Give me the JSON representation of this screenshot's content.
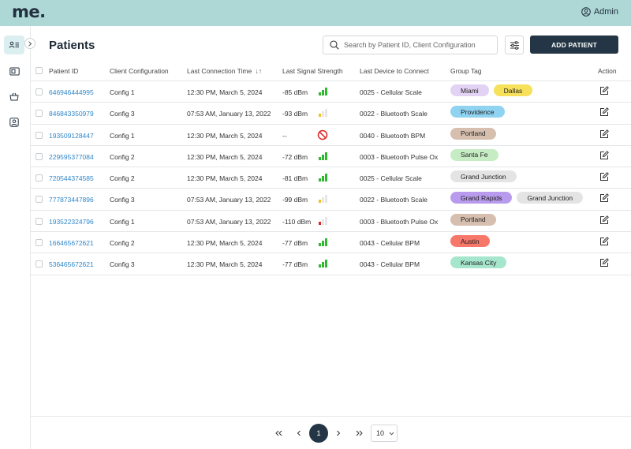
{
  "app": {
    "logo": "me.",
    "user_label": "Admin"
  },
  "sidebar": {
    "items": [
      {
        "icon": "patients-list-icon",
        "active": true
      },
      {
        "icon": "device-card-icon",
        "active": false
      },
      {
        "icon": "basket-icon",
        "active": false
      },
      {
        "icon": "user-profile-icon",
        "active": false
      }
    ],
    "collapse_icon": "chevron-right-icon"
  },
  "header": {
    "title": "Patients",
    "search_placeholder": "Search by Patient ID, Client Configuration",
    "add_button_label": "ADD PATIENT"
  },
  "table": {
    "columns": {
      "patient_id": "Patient ID",
      "client_configuration": "Client Configuration",
      "last_connection_time": "Last Connection Time",
      "last_signal_strength": "Last Signal Strength",
      "last_device": "Last Device to Connect",
      "group_tag": "Group Tag",
      "action": "Action"
    },
    "sort_indicator": "↓↑",
    "rows": [
      {
        "patient_id": "646946444995",
        "config": "Config 1",
        "time": "12:30 PM, March 5, 2024",
        "signal": "-85 dBm",
        "signal_level": "strong",
        "device": "0025 - Cellular Scale",
        "tags": [
          "Miami",
          "Dallas"
        ]
      },
      {
        "patient_id": "846843350979",
        "config": "Config 3",
        "time": "07:53 AM, January 13, 2022",
        "signal": "-93 dBm",
        "signal_level": "medium",
        "device": "0022 - Bluetooth Scale",
        "tags": [
          "Providence"
        ]
      },
      {
        "patient_id": "193509128447",
        "config": "Config 1",
        "time": "12:30 PM, March 5, 2024",
        "signal": "--",
        "signal_level": "none",
        "device": "0040 - Bluetooth BPM",
        "tags": [
          "Portland"
        ]
      },
      {
        "patient_id": "229595377084",
        "config": "Config 2",
        "time": "12:30 PM, March 5, 2024",
        "signal": "-72 dBm",
        "signal_level": "strong",
        "device": "0003 - Bluetooth Pulse Ox",
        "tags": [
          "Santa Fe"
        ]
      },
      {
        "patient_id": "720544374585",
        "config": "Config 2",
        "time": "12:30 PM, March 5, 2024",
        "signal": "-81 dBm",
        "signal_level": "strong",
        "device": "0025 - Cellular Scale",
        "tags": [
          "Grand Junction"
        ]
      },
      {
        "patient_id": "777873447896",
        "config": "Config 3",
        "time": "07:53 AM, January 13, 2022",
        "signal": "-99 dBm",
        "signal_level": "medium",
        "device": "0022 - Bluetooth Scale",
        "tags": [
          "Grand Rapids",
          "Grand Junction"
        ]
      },
      {
        "patient_id": "193522324796",
        "config": "Config 1",
        "time": "07:53 AM, January 13, 2022",
        "signal": "-110 dBm",
        "signal_level": "weak",
        "device": "0003 - Bluetooth Pulse Ox",
        "tags": [
          "Portland"
        ]
      },
      {
        "patient_id": "166465672621",
        "config": "Config 2",
        "time": "12:30 PM, March 5, 2024",
        "signal": "-77 dBm",
        "signal_level": "strong",
        "device": "0043 - Cellular BPM",
        "tags": [
          "Austin"
        ]
      },
      {
        "patient_id": "536465672621",
        "config": "Config 3",
        "time": "12:30 PM, March 5, 2024",
        "signal": "-77 dBm",
        "signal_level": "strong",
        "device": "0043 - Cellular BPM",
        "tags": [
          "Kansas City"
        ]
      }
    ]
  },
  "tag_colors": {
    "Miami": "#e2d2f3",
    "Dallas": "#f7e05a",
    "Providence": "#8fd3f1",
    "Portland": "#d6bfae",
    "Santa Fe": "#c6ecc3",
    "Grand Junction": "#e4e4e4",
    "Grand Rapids": "#b99bee",
    "Austin": "#f7776b",
    "Kansas City": "#a6e6cd"
  },
  "signal_colors": {
    "strong": "#2eb82e",
    "medium": "#f4c21f",
    "weak": "#e02424",
    "inactive": "#e6e6e6",
    "none": "#d92626"
  },
  "pagination": {
    "current_page": "1",
    "per_page": "10"
  }
}
